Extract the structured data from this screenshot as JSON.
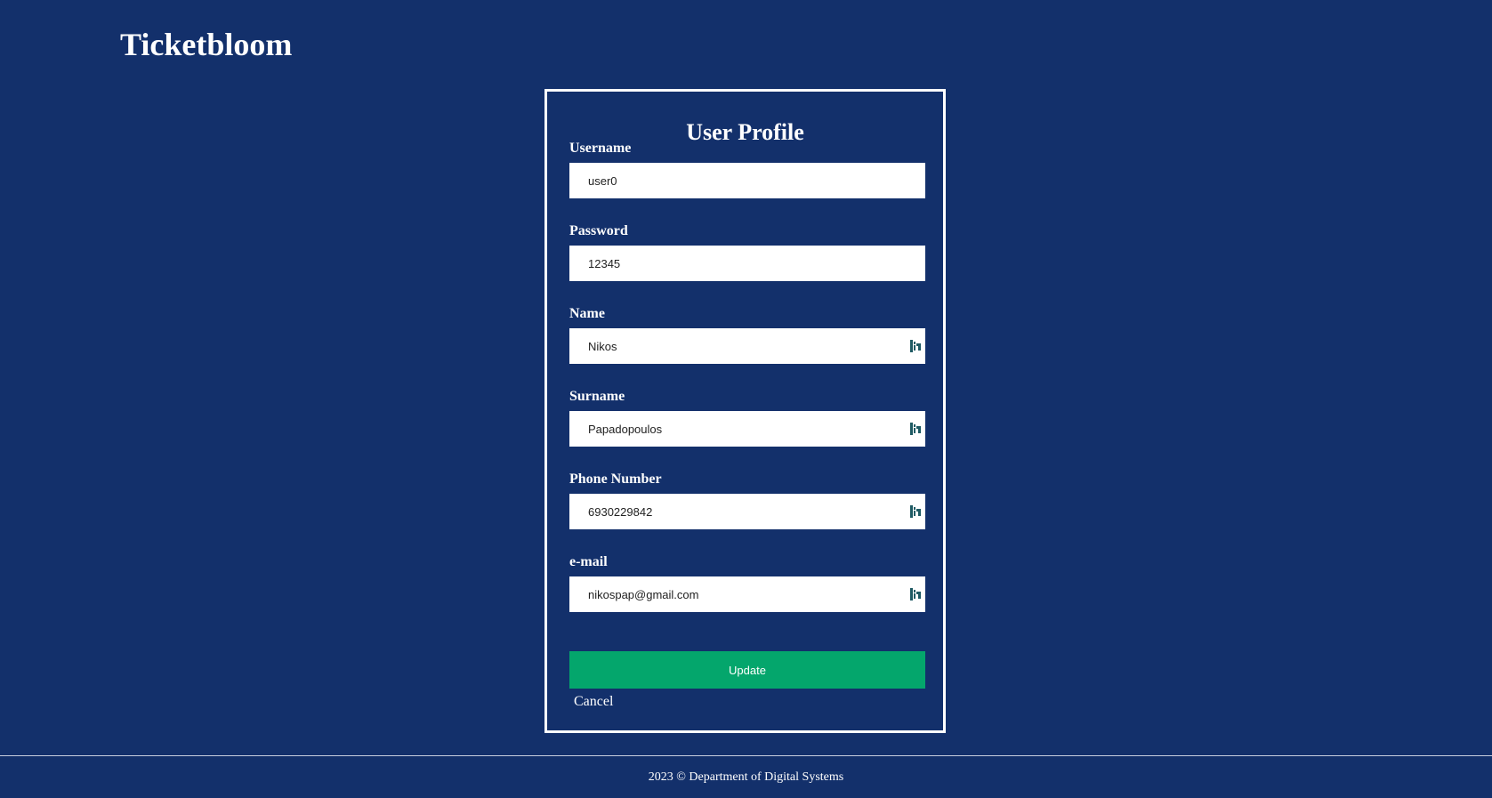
{
  "site": {
    "brand": "Ticketbloom"
  },
  "form": {
    "title": "User Profile",
    "fields": [
      {
        "label": "Username",
        "value": "user0",
        "autofill_icon": false
      },
      {
        "label": "Password",
        "value": "12345",
        "autofill_icon": false
      },
      {
        "label": "Name",
        "value": "Nikos",
        "autofill_icon": true
      },
      {
        "label": "Surname",
        "value": "Papadopoulos",
        "autofill_icon": true
      },
      {
        "label": "Phone Number",
        "value": "6930229842",
        "autofill_icon": true
      },
      {
        "label": "e-mail",
        "value": "nikospap@gmail.com",
        "autofill_icon": true
      }
    ],
    "update_label": "Update",
    "cancel_label": "Cancel"
  },
  "footer": {
    "text": "2023 © Department of Digital Systems"
  },
  "colors": {
    "background": "#13306b",
    "primary_button": "#04a66c",
    "autofill_icon": "#1e5a63"
  },
  "icons": {
    "autofill": "password-manager-autofill-icon"
  }
}
